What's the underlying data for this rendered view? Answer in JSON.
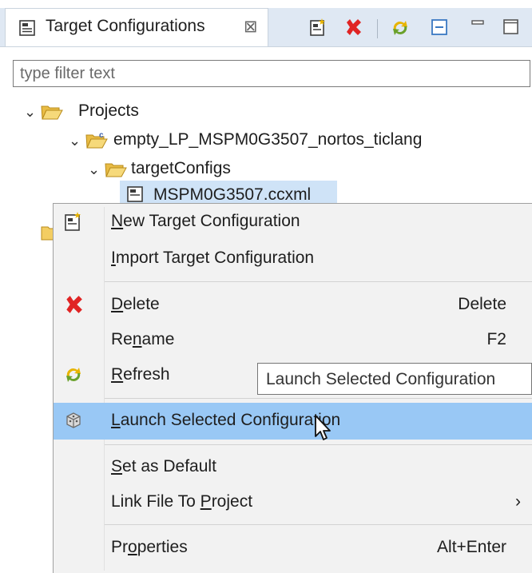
{
  "view": {
    "tab_title": "Target Configurations",
    "tab_close_icon": "close-icon",
    "toolbar": [
      {
        "name": "new-target-config-icon",
        "action": "New Target Configuration"
      },
      {
        "name": "delete-icon",
        "action": "Delete"
      },
      {
        "name": "refresh-icon",
        "action": "Refresh"
      },
      {
        "name": "collapse-all-icon",
        "action": "Collapse All"
      },
      {
        "name": "minimize-icon",
        "action": "Minimize"
      },
      {
        "name": "maximize-icon",
        "action": "Maximize"
      }
    ]
  },
  "filter": {
    "placeholder": "type filter text",
    "value": ""
  },
  "tree": {
    "projects_label": "Projects",
    "project_label": "empty_LP_MSPM0G3507_nortos_ticlang",
    "folder_label": "targetConfigs",
    "file_label": "MSPM0G3507.ccxml",
    "second_root_icon": "folder-icon"
  },
  "context_menu": {
    "items": [
      {
        "pre": "",
        "mn": "N",
        "post": "ew Target Configuration",
        "shortcut": "",
        "icon": "new-target-config-icon",
        "highlighted": false
      },
      {
        "pre": "",
        "mn": "I",
        "post": "mport Target Configuration",
        "shortcut": "",
        "icon": "",
        "highlighted": false
      },
      {
        "pre": "",
        "mn": "D",
        "post": "elete",
        "shortcut": "Delete",
        "icon": "delete-icon",
        "highlighted": false
      },
      {
        "pre": "Re",
        "mn": "n",
        "post": "ame",
        "shortcut": "F2",
        "icon": "",
        "highlighted": false
      },
      {
        "pre": "",
        "mn": "R",
        "post": "efresh",
        "shortcut": "",
        "icon": "refresh-icon",
        "highlighted": false
      },
      {
        "pre": "",
        "mn": "L",
        "post": "aunch Selected Configuration",
        "shortcut": "",
        "icon": "launch-icon",
        "highlighted": true
      },
      {
        "pre": "",
        "mn": "S",
        "post": "et as Default",
        "shortcut": "",
        "icon": "",
        "highlighted": false
      },
      {
        "pre": "Link File To ",
        "mn": "P",
        "post": "roject",
        "shortcut": "›",
        "icon": "",
        "highlighted": false
      },
      {
        "pre": "Pr",
        "mn": "o",
        "post": "perties",
        "shortcut": "Alt+Enter",
        "icon": "",
        "highlighted": false
      }
    ],
    "tooltip": "Launch Selected Configuration"
  },
  "colors": {
    "highlight": "#99c8f5",
    "menu_bg": "#f2f2f2",
    "delete_red": "#e02424",
    "folder": "#f3cd62",
    "tabbar_bg": "#dfe8f3"
  }
}
